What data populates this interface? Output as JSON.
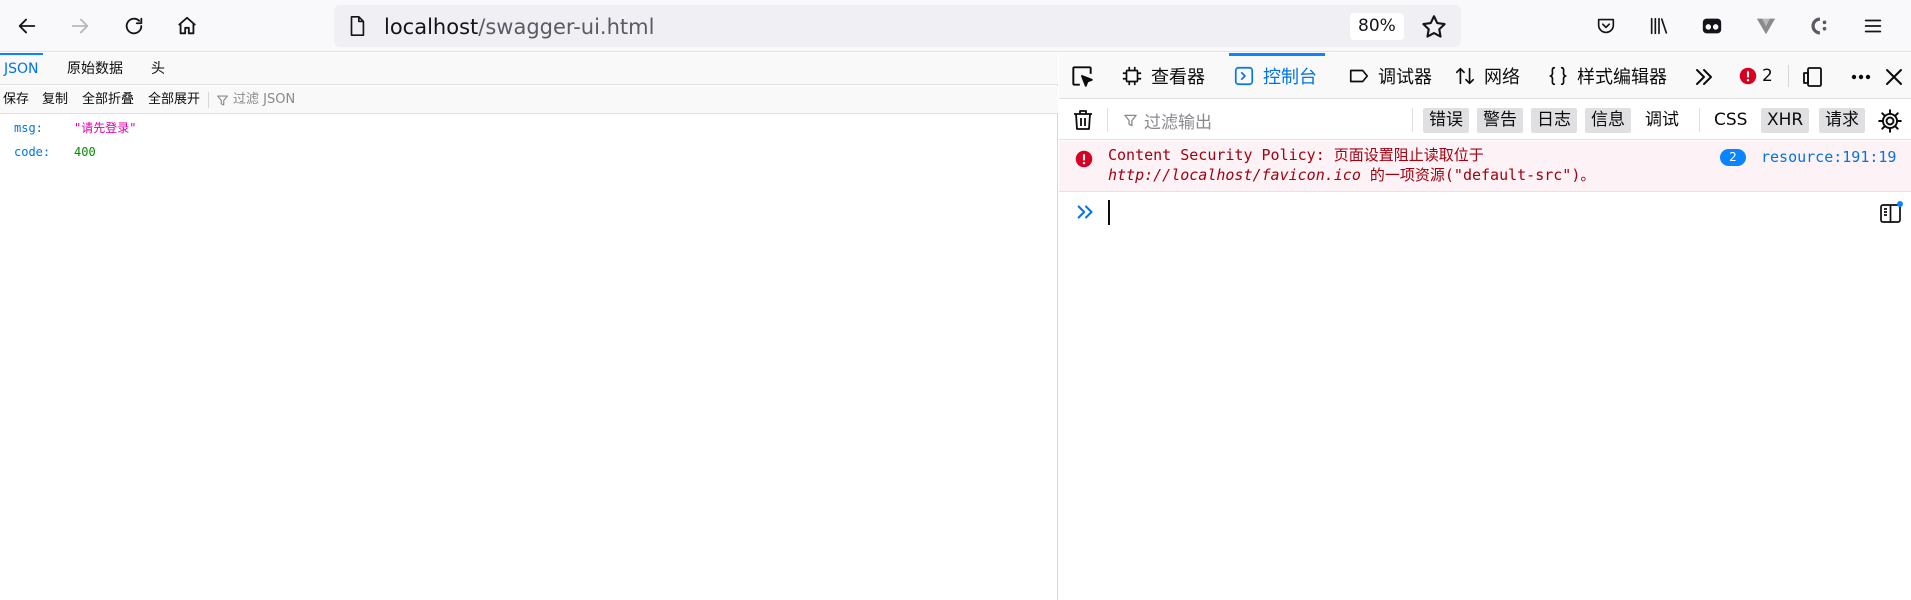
{
  "browser": {
    "url_host": "localhost",
    "url_path": "/swagger-ui.html",
    "zoom": "80%",
    "icons": {
      "back": "back-arrow-icon",
      "forward": "forward-arrow-icon",
      "reload": "reload-icon",
      "home": "home-icon",
      "page": "page-info-icon",
      "bookmark": "star-icon",
      "pocket": "pocket-icon",
      "library": "library-icon",
      "extension_1": "extension-mask-icon",
      "extension_2": "extension-v-icon",
      "extension_3": "extension-c-icon",
      "menu": "hamburger-menu-icon"
    }
  },
  "json_viewer": {
    "tabs": [
      "JSON",
      "原始数据",
      "头"
    ],
    "active_tab": "JSON",
    "actions": [
      "保存",
      "复制",
      "全部折叠",
      "全部展开"
    ],
    "filter_placeholder": "过滤 JSON",
    "rows": [
      {
        "key": "msg:",
        "value": "\"请先登录\"",
        "type": "string"
      },
      {
        "key": "code:",
        "value": "400",
        "type": "number"
      }
    ]
  },
  "devtools": {
    "tabs": [
      "查看器",
      "控制台",
      "调试器",
      "网络",
      "样式编辑器"
    ],
    "active_tab": "控制台",
    "error_count": "2",
    "filter_placeholder": "过滤输出",
    "levels": [
      {
        "label": "错误",
        "on": true
      },
      {
        "label": "警告",
        "on": true
      },
      {
        "label": "日志",
        "on": true
      },
      {
        "label": "信息",
        "on": true
      },
      {
        "label": "调试",
        "on": false
      }
    ],
    "categories": [
      {
        "label": "CSS",
        "on": false
      },
      {
        "label": "XHR",
        "on": true
      },
      {
        "label": "请求",
        "on": true
      }
    ],
    "messages": [
      {
        "level": "error",
        "text_before": "Content Security Policy: 页面设置阻止读取位于 ",
        "url": "http://localhost/favicon.ico",
        "text_after": " 的一项资源(\"default-src\")。",
        "repeat": "2",
        "location": "resource:191:19"
      }
    ],
    "colors": {
      "accent": "#0a84ff",
      "error_text": "#a4000f",
      "error_bg": "#fdf2f5"
    }
  }
}
